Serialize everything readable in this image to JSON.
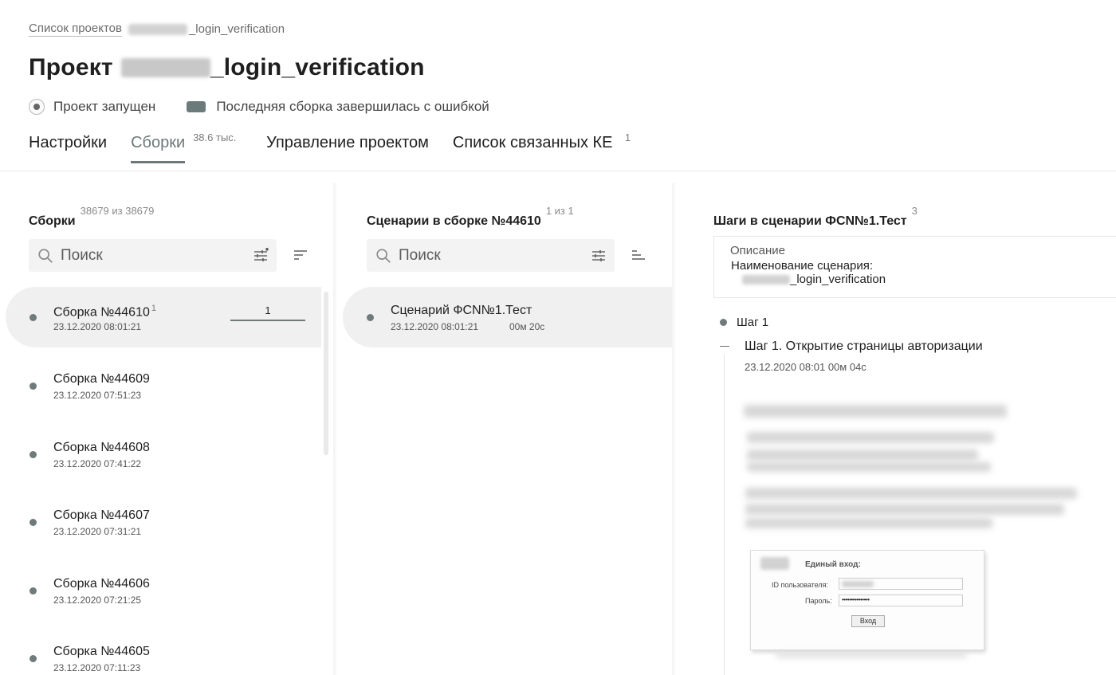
{
  "breadcrumb": {
    "root": "Список проектов",
    "separator": "/",
    "current_suffix": "_login_verification"
  },
  "project": {
    "title_prefix": "Проект",
    "title_suffix": "_login_verification",
    "status": "Проект запущен",
    "last_build": "Последняя сборка завершилась с ошибкой"
  },
  "tabs": [
    {
      "label": "Настройки",
      "count": ""
    },
    {
      "label": "Сборки",
      "count": "38.6 тыс."
    },
    {
      "label": "Управление проектом",
      "count": ""
    },
    {
      "label": "Список связанных КЕ",
      "count": "1"
    }
  ],
  "builds": {
    "title": "Сборки",
    "count": "38679 из 38679",
    "search_placeholder": "Поиск",
    "items": [
      {
        "name": "Сборка №44610",
        "badge": "1",
        "date": "23.12.2020 08:01:21",
        "progress_label": "1",
        "progress": 1.0
      },
      {
        "name": "Сборка №44609",
        "badge": "",
        "date": "23.12.2020 07:51:23"
      },
      {
        "name": "Сборка №44608",
        "badge": "",
        "date": "23.12.2020 07:41:22"
      },
      {
        "name": "Сборка №44607",
        "badge": "",
        "date": "23.12.2020 07:31:21"
      },
      {
        "name": "Сборка №44606",
        "badge": "",
        "date": "23.12.2020 07:21:25"
      },
      {
        "name": "Сборка №44605",
        "badge": "",
        "date": "23.12.2020 07:11:23"
      }
    ]
  },
  "scenarios": {
    "title": "Сценарии в сборке №44610",
    "count": "1 из 1",
    "search_placeholder": "Поиск",
    "items": [
      {
        "name": "Сценарий ФСN№1.Тест",
        "date": "23.12.2020 08:01:21",
        "duration": "00м 20с"
      }
    ]
  },
  "steps": {
    "title": "Шаги в сценарии ФСN№1.Тест",
    "count": "3",
    "description_title": "Описание",
    "scenario_name_label": "Наименование сценария:",
    "scenario_name_suffix": "_login_verification",
    "step_label": "Шаг 1",
    "substep_title": "Шаг 1. Открытие страницы авторизации",
    "substep_meta": "23.12.2020 08:01 00м 04с",
    "login_form": {
      "title": "Единый вход:",
      "user_label": "ID пользователя:",
      "password_label": "Пароль:",
      "password_value": "•••••••••••••••",
      "submit": "Вход"
    }
  },
  "colors": {
    "accent": "#6d7878",
    "selected_bg": "#f0f0f0",
    "search_bg": "#f3f3f3"
  }
}
